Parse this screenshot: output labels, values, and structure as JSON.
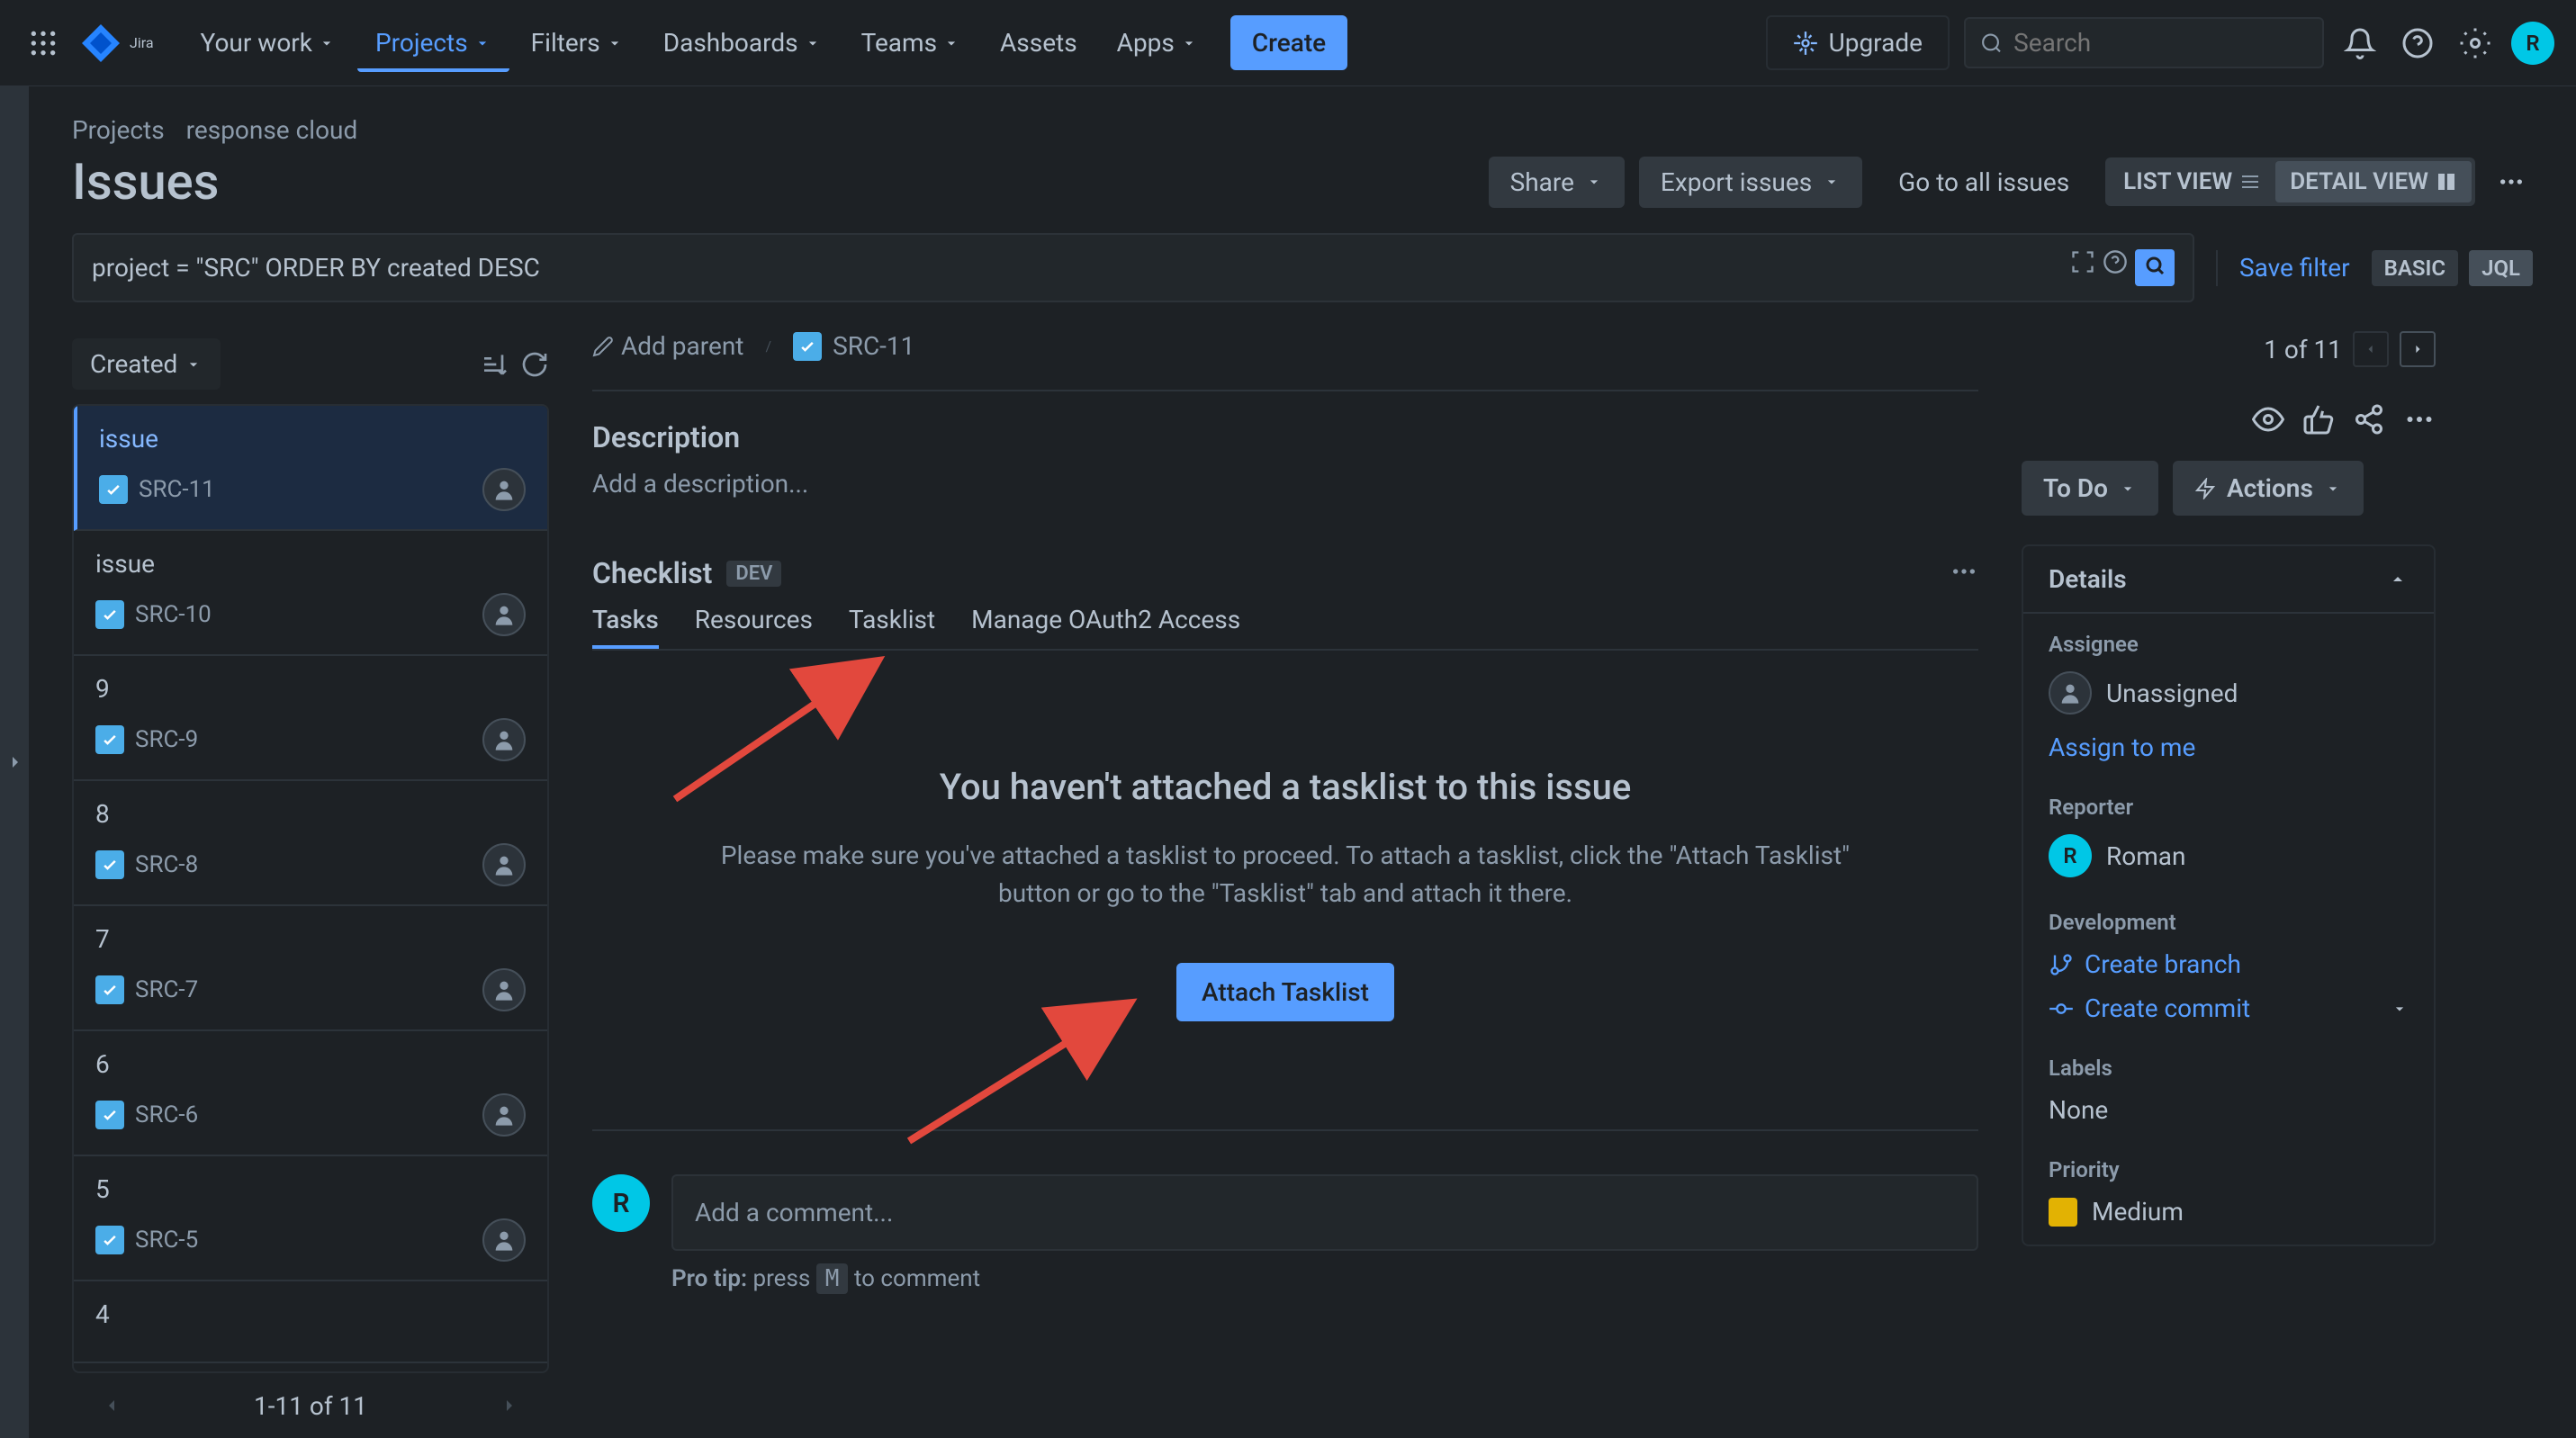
{
  "topbar": {
    "nav": {
      "your_work": "Your work",
      "projects": "Projects",
      "filters": "Filters",
      "dashboards": "Dashboards",
      "teams": "Teams",
      "assets": "Assets",
      "apps": "Apps"
    },
    "create": "Create",
    "upgrade": "Upgrade",
    "search_placeholder": "Search",
    "logo_text": "Jira"
  },
  "breadcrumb": {
    "projects": "Projects",
    "project_name": "response cloud"
  },
  "page_title": "Issues",
  "toolbar": {
    "share": "Share",
    "export": "Export issues",
    "go_all": "Go to all issues",
    "list_view": "LIST VIEW",
    "detail_view": "DETAIL VIEW"
  },
  "query": "project = \"SRC\" ORDER BY created DESC",
  "save_filter": "Save filter",
  "basic": "BASIC",
  "jql": "JQL",
  "issue_list": {
    "sort": "Created",
    "items": [
      {
        "title": "issue",
        "key": "SRC-11",
        "selected": true
      },
      {
        "title": "issue",
        "key": "SRC-10"
      },
      {
        "title": "9",
        "key": "SRC-9"
      },
      {
        "title": "8",
        "key": "SRC-8"
      },
      {
        "title": "7",
        "key": "SRC-7"
      },
      {
        "title": "6",
        "key": "SRC-6"
      },
      {
        "title": "5",
        "key": "SRC-5"
      },
      {
        "title": "4",
        "key": ""
      }
    ],
    "footer": "1-11 of 11"
  },
  "detail": {
    "add_parent": "Add parent",
    "issue_key": "SRC-11",
    "description_h": "Description",
    "description_placeholder": "Add a description...",
    "checklist_h": "Checklist",
    "dev_badge": "DEV",
    "tabs": {
      "tasks": "Tasks",
      "resources": "Resources",
      "tasklist": "Tasklist",
      "manage": "Manage OAuth2 Access"
    },
    "empty": {
      "title": "You haven't attached a tasklist to this issue",
      "body": "Please make sure you've attached a tasklist to proceed. To attach a tasklist, click the \"Attach Tasklist\" button or go to the \"Tasklist\" tab and attach it there.",
      "button": "Attach Tasklist"
    },
    "comment_placeholder": "Add a comment...",
    "pro_tip_label": "Pro tip:",
    "pro_tip_press": "press",
    "pro_tip_key": "M",
    "pro_tip_rest": "to comment"
  },
  "side": {
    "pager": "1 of 11",
    "to_do": "To Do",
    "actions": "Actions",
    "details_h": "Details",
    "assignee_h": "Assignee",
    "unassigned": "Unassigned",
    "assign_me": "Assign to me",
    "reporter_h": "Reporter",
    "reporter_name": "Roman",
    "development_h": "Development",
    "create_branch": "Create branch",
    "create_commit": "Create commit",
    "labels_h": "Labels",
    "labels_none": "None",
    "priority_h": "Priority",
    "priority_val": "Medium"
  }
}
